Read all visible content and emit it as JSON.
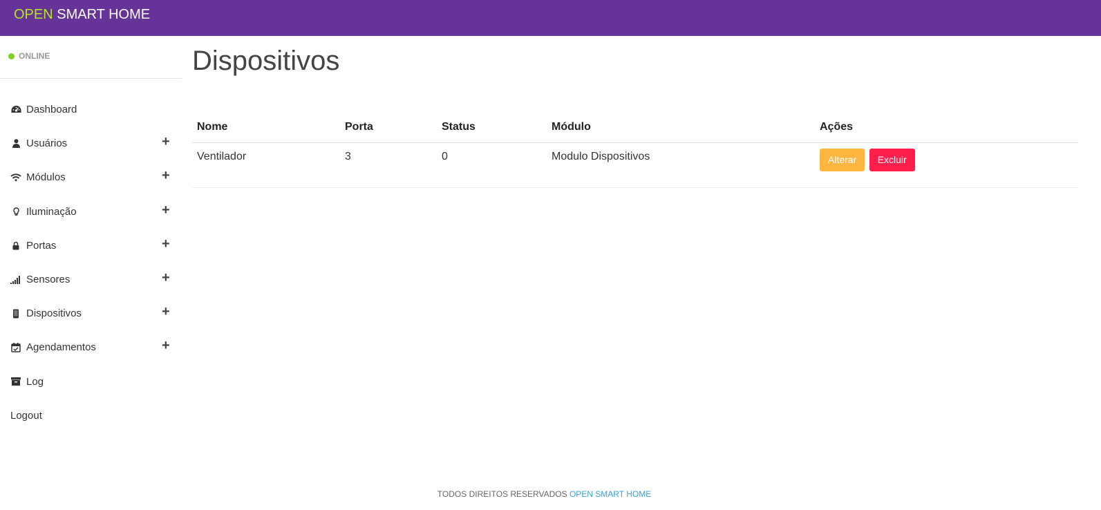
{
  "header": {
    "brand_open": "OPEN",
    "brand_rest": " SMART HOME"
  },
  "sidebar": {
    "status": "ONLINE",
    "items": [
      {
        "label": "Dashboard",
        "icon": "dashboard-icon",
        "expandable": false
      },
      {
        "label": "Usuários",
        "icon": "user-icon",
        "expandable": true
      },
      {
        "label": "Módulos",
        "icon": "wifi-icon",
        "expandable": true
      },
      {
        "label": "Iluminação",
        "icon": "lightbulb-icon",
        "expandable": true
      },
      {
        "label": "Portas",
        "icon": "lock-icon",
        "expandable": true
      },
      {
        "label": "Sensores",
        "icon": "signal-icon",
        "expandable": true
      },
      {
        "label": "Dispositivos",
        "icon": "phone-icon",
        "expandable": true
      },
      {
        "label": "Agendamentos",
        "icon": "calendar-check-icon",
        "expandable": true
      },
      {
        "label": "Log",
        "icon": "archive-icon",
        "expandable": false
      },
      {
        "label": "Logout",
        "icon": "",
        "expandable": false
      }
    ],
    "plus_symbol": "+"
  },
  "main": {
    "title": "Dispositivos",
    "table": {
      "columns": [
        "Nome",
        "Porta",
        "Status",
        "Módulo",
        "Ações"
      ],
      "rows": [
        {
          "nome": "Ventilador",
          "porta": "3",
          "status": "0",
          "modulo": "Modulo Dispositivos"
        }
      ],
      "actions": {
        "edit_label": "Alterar",
        "delete_label": "Excluir"
      }
    }
  },
  "footer": {
    "text": "TODOS DIREITOS RESERVADOS ",
    "link": "OPEN SMART HOME"
  },
  "colors": {
    "header": "#663399",
    "brand_accent": "#b5e61d",
    "online": "#7cd320",
    "edit": "#ffb640",
    "delete": "#ff1f4d",
    "link": "#3aa0dc"
  }
}
